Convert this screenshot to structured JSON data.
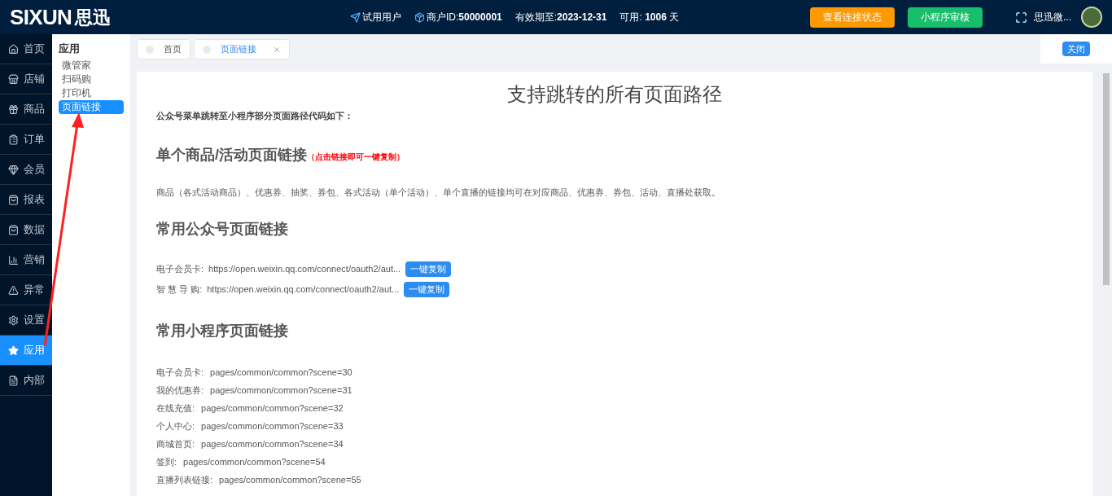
{
  "header": {
    "logo_latin": "SIXUN",
    "logo_cjk": "思迅",
    "trial_user": "试用用户",
    "merchant_label": "商户ID:",
    "merchant_id": "50000001",
    "expiry_label": "有效期至:",
    "expiry_date": "2023-12-31",
    "available_label": "可用:",
    "available_days": "1006",
    "days_unit": "天",
    "buttons": [
      {
        "label": "查看连接状态",
        "color": "#ff9900"
      },
      {
        "label": "小程序审核",
        "color": "#19be6b"
      }
    ],
    "user_name": "思迅微..."
  },
  "nav": [
    {
      "label": "首页",
      "selected": false
    },
    {
      "label": "店铺",
      "selected": false
    },
    {
      "label": "商品",
      "selected": false
    },
    {
      "label": "订单",
      "selected": false
    },
    {
      "label": "会员",
      "selected": false
    },
    {
      "label": "报表",
      "selected": false
    },
    {
      "label": "数据",
      "selected": false
    },
    {
      "label": "营销",
      "selected": false
    },
    {
      "label": "异常",
      "selected": false
    },
    {
      "label": "设置",
      "selected": false
    },
    {
      "label": "应用",
      "selected": true
    },
    {
      "label": "内部",
      "selected": false
    }
  ],
  "submenu": {
    "title": "应用",
    "items": [
      {
        "label": "微管家",
        "selected": false
      },
      {
        "label": "扫码购",
        "selected": false
      },
      {
        "label": "打印机",
        "selected": false
      },
      {
        "label": "页面链接",
        "selected": true
      }
    ]
  },
  "tabs": [
    {
      "label": "首页",
      "selected": false,
      "closable": false
    },
    {
      "label": "页面链接",
      "selected": true,
      "closable": true
    }
  ],
  "close_button": "关闭",
  "content": {
    "title": "支持跳转的所有页面路径",
    "intro": "公众号菜单跳转至小程序部分页面路径代码如下：",
    "section1": {
      "heading": "单个商品/活动页面链接",
      "hint": "（点击链接即可一键复制）",
      "text": "商品（各式活动商品）、优惠券、抽奖、券包、各式活动（单个活动）、单个直播的链接均可在对应商品、优惠券、券包、活动、直播处获取。"
    },
    "section2": {
      "heading": "常用公众号页面链接",
      "links": [
        {
          "label": "电子会员卡:",
          "url": "https://open.weixin.qq.com/connect/oauth2/aut...",
          "button": "一键复制"
        },
        {
          "label": "智 慧 导 购:",
          "url": "https://open.weixin.qq.com/connect/oauth2/aut...",
          "button": "一键复制"
        }
      ]
    },
    "section3": {
      "heading": "常用小程序页面链接",
      "paths": [
        {
          "label": "电子会员卡:",
          "path": "pages/common/common?scene=30"
        },
        {
          "label": "我的优惠券:",
          "path": "pages/common/common?scene=31"
        },
        {
          "label": "在线充值:",
          "path": "pages/common/common?scene=32"
        },
        {
          "label": "个人中心:",
          "path": "pages/common/common?scene=33"
        },
        {
          "label": "商城首页:",
          "path": "pages/common/common?scene=34"
        },
        {
          "label": "签到:",
          "path": "pages/common/common?scene=54"
        },
        {
          "label": "直播列表链接:",
          "path": "pages/common/common?scene=55"
        }
      ]
    }
  }
}
